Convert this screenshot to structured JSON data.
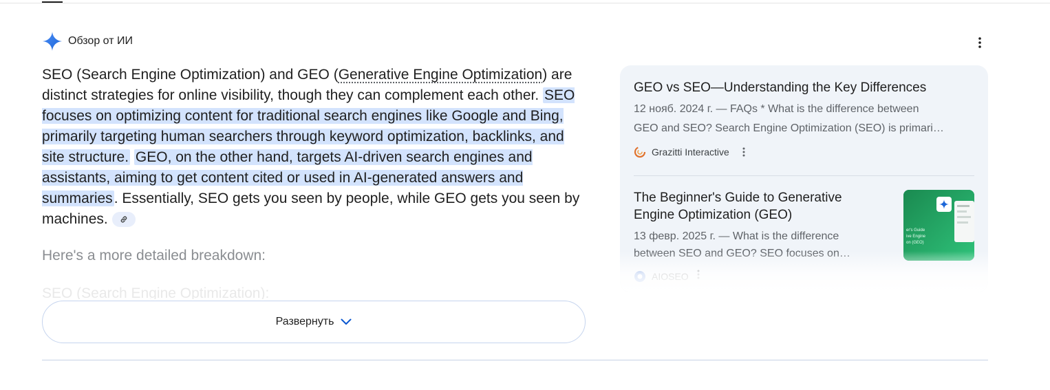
{
  "overview": {
    "title": "Обзор от ИИ"
  },
  "answer": {
    "seg1": "SEO (Search Engine Optimization) and GEO (",
    "seg_link": "Generative Engine Optimization",
    "seg2": ") are distinct strategies for online visibility, though they can complement each other. ",
    "hl1": "SEO focuses on optimizing content for traditional search engines like Google and Bing, primarily targeting human searchers through keyword optimization, backlinks, and site structure.",
    "hl2": "GEO, on the other hand, targets AI-driven search engines and assistants, aiming to get content cited or used in AI-generated answers and summaries",
    "seg3": ". Essentially, SEO gets you seen by people, while GEO gets you seen by machines."
  },
  "breakdown": "Here's a more detailed breakdown:",
  "faded_heading": "SEO (Search Engine Optimization):",
  "expand_label": "Развернуть",
  "sources": [
    {
      "title": "GEO vs SEO—Understanding the Key Differences",
      "snippet_line1": "12 нояб. 2024 г. — FAQs * What is the difference between",
      "snippet_line2": "GEO and SEO? Search Engine Optimization (SEO) is primari…",
      "site": "Grazitti Interactive"
    },
    {
      "title": "The Beginner's Guide to Generative Engine Optimization (GEO)",
      "snippet_line1": "13 февр. 2025 г. — What is the difference",
      "snippet_line2": "between SEO and GEO? SEO focuses on…",
      "site": "AIOSEO"
    }
  ],
  "thumbnail_text": "er's Guide\nive Engine\non (GEO)",
  "colors": {
    "highlight": "#d3e3fd",
    "accent": "#0b57d0",
    "panel": "#f0f4f9"
  }
}
